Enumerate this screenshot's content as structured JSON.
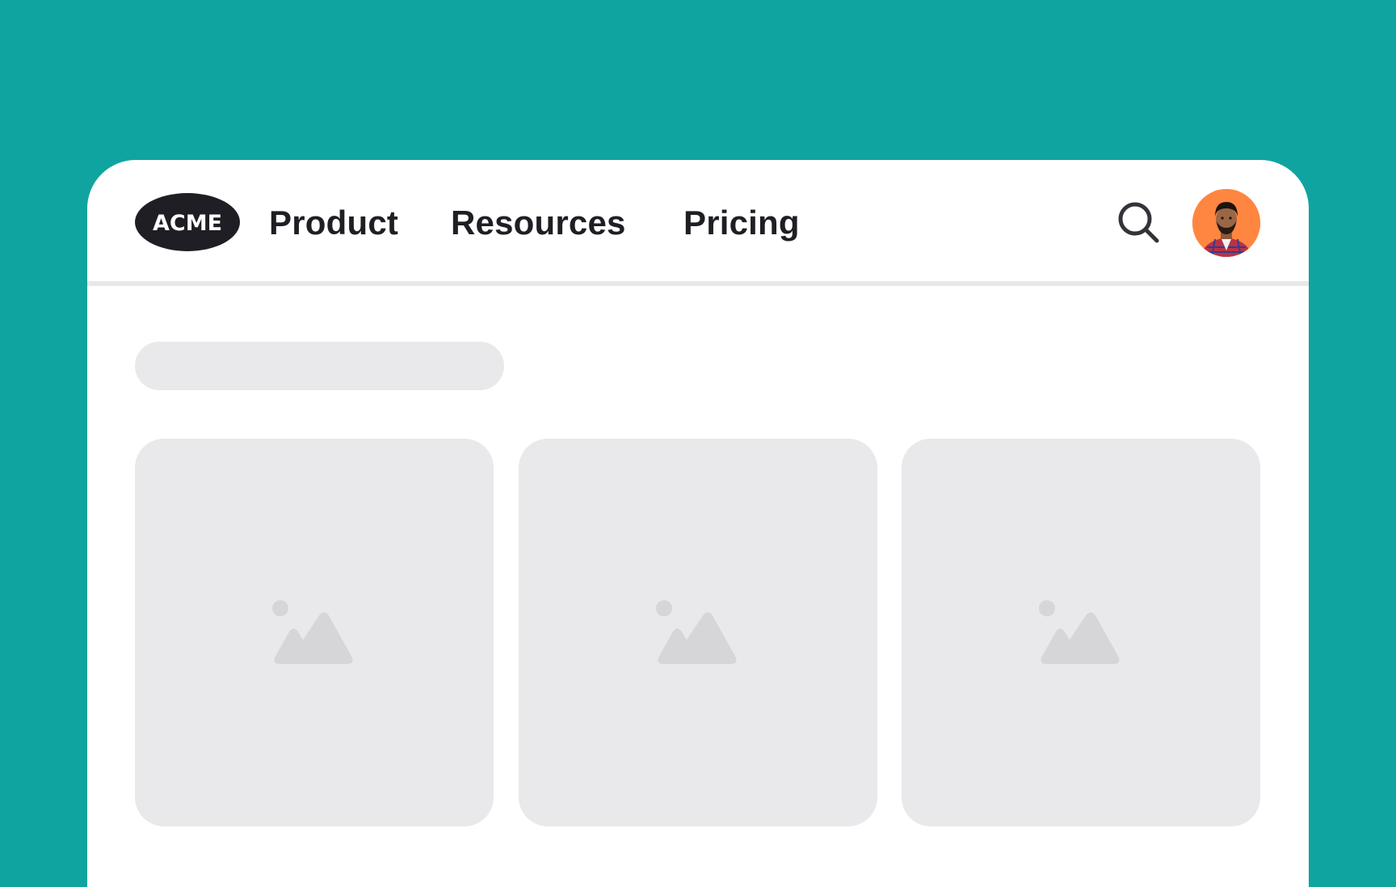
{
  "brand": {
    "logo_text": "ACME",
    "logo_icon": "acme-logo"
  },
  "nav": {
    "items": [
      {
        "label": "Product"
      },
      {
        "label": "Resources"
      },
      {
        "label": "Pricing"
      }
    ]
  },
  "actions": {
    "search_icon": "search-icon",
    "avatar_icon": "user-avatar"
  },
  "content": {
    "tiles": [
      {
        "icon": "image-placeholder-icon"
      },
      {
        "icon": "image-placeholder-icon"
      },
      {
        "icon": "image-placeholder-icon"
      }
    ]
  },
  "colors": {
    "background": "#10a4a0",
    "card": "#ffffff",
    "text": "#1e1e24",
    "skeleton": "#e9e9eb",
    "placeholder_icon": "#d6d6d9",
    "avatar_bg": "#ff8640",
    "logo_bg": "#1e1e24"
  }
}
